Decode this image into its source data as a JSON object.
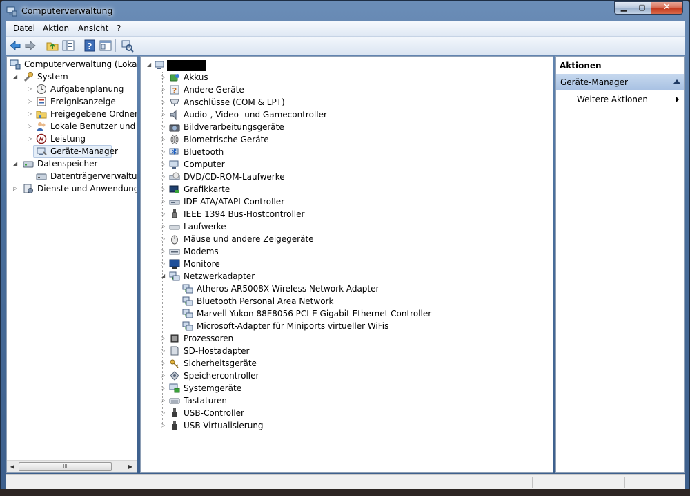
{
  "window": {
    "title": "Computerverwaltung"
  },
  "menu": [
    "Datei",
    "Aktion",
    "Ansicht",
    "?"
  ],
  "toolbar": {
    "buttons": [
      "back-icon",
      "forward-icon",
      "up-folder-icon",
      "show-tree-icon",
      "help-icon",
      "properties-icon",
      "scan-hardware-icon"
    ]
  },
  "tree": [
    {
      "label": "Computerverwaltung (Lokal)",
      "icon": "computer-management-icon"
    },
    {
      "label": "System",
      "icon": "system-tools-icon"
    },
    {
      "label": "Aufgabenplanung",
      "icon": "clock-icon"
    },
    {
      "label": "Ereignisanzeige",
      "icon": "event-viewer-icon"
    },
    {
      "label": "Freigegebene Ordner",
      "icon": "shared-folder-icon"
    },
    {
      "label": "Lokale Benutzer und Gr",
      "icon": "users-icon"
    },
    {
      "label": "Leistung",
      "icon": "performance-icon"
    },
    {
      "label": "Geräte-Manager",
      "icon": "device-manager-icon"
    },
    {
      "label": "Datenspeicher",
      "icon": "storage-icon"
    },
    {
      "label": "Datenträgerverwaltung",
      "icon": "disk-icon"
    },
    {
      "label": "Dienste und Anwendungen",
      "icon": "services-icon"
    }
  ],
  "devices": [
    {
      "label": "Akkus",
      "icon": "battery-icon"
    },
    {
      "label": "Andere Geräte",
      "icon": "unknown-device-icon"
    },
    {
      "label": "Anschlüsse (COM & LPT)",
      "icon": "port-icon"
    },
    {
      "label": "Audio-, Video- und Gamecontroller",
      "icon": "speaker-icon"
    },
    {
      "label": "Bildverarbeitungsgeräte",
      "icon": "camera-icon"
    },
    {
      "label": "Biometrische Geräte",
      "icon": "fingerprint-icon"
    },
    {
      "label": "Bluetooth",
      "icon": "bluetooth-icon"
    },
    {
      "label": "Computer",
      "icon": "computer-icon"
    },
    {
      "label": "DVD/CD-ROM-Laufwerke",
      "icon": "dvd-icon"
    },
    {
      "label": "Grafikkarte",
      "icon": "display-adapter-icon"
    },
    {
      "label": "IDE ATA/ATAPI-Controller",
      "icon": "ide-icon"
    },
    {
      "label": "IEEE 1394 Bus-Hostcontroller",
      "icon": "firewire-icon"
    },
    {
      "label": "Laufwerke",
      "icon": "drive-icon"
    },
    {
      "label": "Mäuse und andere Zeigegeräte",
      "icon": "mouse-icon"
    },
    {
      "label": "Modems",
      "icon": "modem-icon"
    },
    {
      "label": "Monitore",
      "icon": "monitor-icon"
    },
    {
      "label": "Netzwerkadapter",
      "icon": "network-icon"
    },
    {
      "label": "Atheros AR5008X Wireless Network Adapter",
      "icon": "network-adapter-icon"
    },
    {
      "label": "Bluetooth Personal Area Network",
      "icon": "network-adapter-icon"
    },
    {
      "label": "Marvell Yukon 88E8056 PCI-E Gigabit Ethernet Controller",
      "icon": "network-adapter-icon"
    },
    {
      "label": "Microsoft-Adapter für Miniports virtueller WiFis",
      "icon": "network-adapter-icon"
    },
    {
      "label": "Prozessoren",
      "icon": "processor-icon"
    },
    {
      "label": "SD-Hostadapter",
      "icon": "sd-card-icon"
    },
    {
      "label": "Sicherheitsgeräte",
      "icon": "key-icon"
    },
    {
      "label": "Speichercontroller",
      "icon": "storage-controller-icon"
    },
    {
      "label": "Systemgeräte",
      "icon": "system-device-icon"
    },
    {
      "label": "Tastaturen",
      "icon": "keyboard-icon"
    },
    {
      "label": "USB-Controller",
      "icon": "usb-icon"
    },
    {
      "label": "USB-Virtualisierung",
      "icon": "usb-icon"
    }
  ],
  "actions": {
    "header": "Aktionen",
    "section": "Geräte-Manager",
    "more": "Weitere Aktionen"
  },
  "scrollbar": {
    "thumb_grip": "III"
  }
}
